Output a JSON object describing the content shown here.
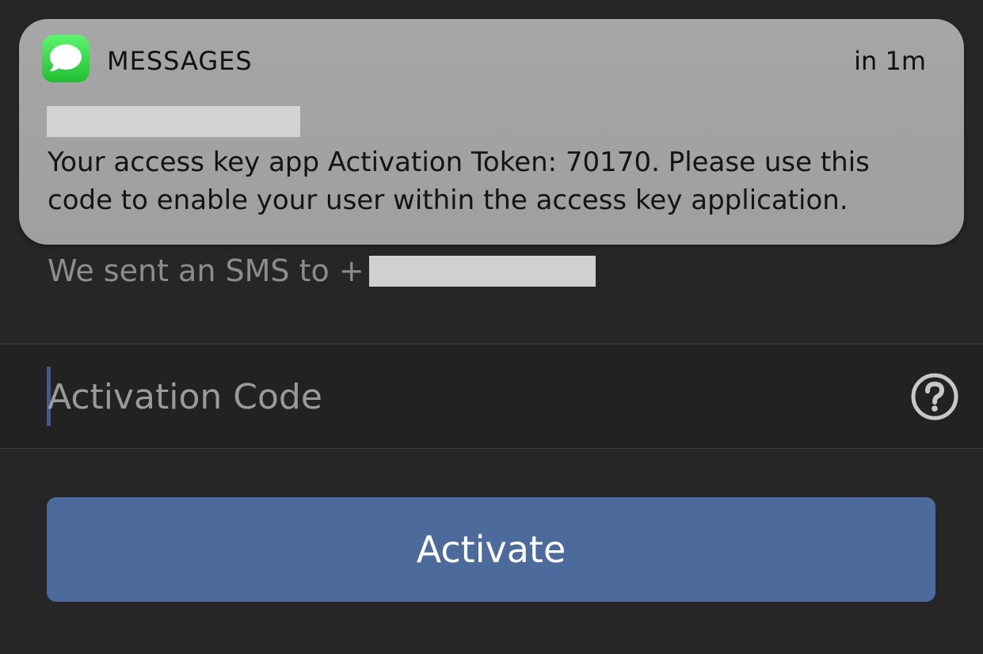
{
  "notification": {
    "app_name": "MESSAGES",
    "time": "in 1m",
    "sender_redacted": true,
    "body": "Your access key app Activation Token: 70170. Please use this code to enable your user within the access key application.",
    "app_icon": "messages-bubble-icon",
    "icon_color": "#28cd41"
  },
  "sms_notice": {
    "text": "We sent an SMS to +",
    "phone_redacted": true
  },
  "activation_field": {
    "placeholder": "Activation Code",
    "value": "",
    "help_icon": "question-circle-icon"
  },
  "activate_button": {
    "label": "Activate",
    "color": "#4c6b9c"
  },
  "colors": {
    "background": "#262626",
    "notification_bg": "#a3a3a3"
  }
}
